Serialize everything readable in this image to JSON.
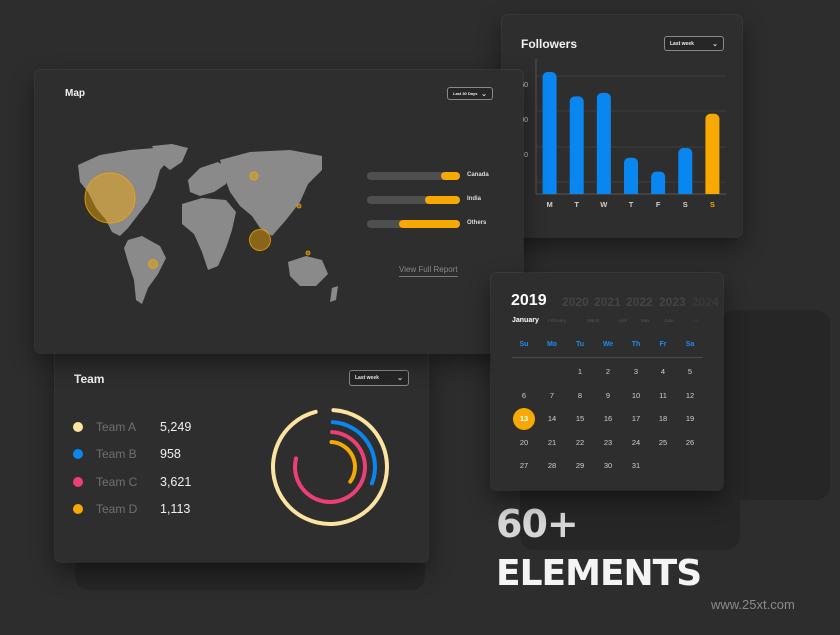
{
  "map_card": {
    "title": "Map",
    "dropdown": "Last 30 Days",
    "countries": [
      {
        "name": "Canada",
        "share": 0.2
      },
      {
        "name": "India",
        "share": 0.38
      },
      {
        "name": "Others",
        "share": 0.66
      }
    ],
    "bubbles": [
      {
        "region": "North America",
        "size": "large"
      },
      {
        "region": "India",
        "size": "medium"
      },
      {
        "region": "Brazil",
        "size": "small"
      },
      {
        "region": "Russia",
        "size": "small"
      },
      {
        "region": "China",
        "size": "tiny"
      },
      {
        "region": "Indonesia",
        "size": "tiny"
      }
    ],
    "view_report": "View Full Report",
    "accent": "#f7a900"
  },
  "followers_card": {
    "title": "Followers",
    "dropdown": "Last week",
    "chart_data": {
      "type": "bar",
      "title": "Followers",
      "categories": [
        "M",
        "T",
        "W",
        "T",
        "F",
        "S",
        "S"
      ],
      "values": [
        175,
        140,
        145,
        52,
        32,
        66,
        115
      ],
      "highlight_index": 6,
      "ytick_labels": [
        "50",
        "00",
        "0"
      ],
      "ylim": [
        0,
        185
      ],
      "grid": true,
      "colors": {
        "default": "#0a86f0",
        "highlight": "#f7a900"
      }
    }
  },
  "team_card": {
    "title": "Team",
    "dropdown": "Last week",
    "teams": [
      {
        "name": "Team A",
        "value": "5,249",
        "color": "#fde3a0"
      },
      {
        "name": "Team B",
        "value": "958",
        "color": "#0a86f0"
      },
      {
        "name": "Team C",
        "value": "3,621",
        "color": "#ec3f74"
      },
      {
        "name": "Team D",
        "value": "1,113",
        "color": "#f7a900"
      }
    ],
    "chart_data": {
      "type": "radial-bar",
      "categories": [
        "Team A",
        "Team B",
        "Team C",
        "Team D"
      ],
      "fractions": [
        0.95,
        0.3,
        0.78,
        0.34
      ]
    }
  },
  "calendar": {
    "years": [
      "2019",
      "2020",
      "2021",
      "2022",
      "2023",
      "2024"
    ],
    "active_year": "2019",
    "months": [
      "January",
      "February",
      "March",
      "April",
      "May",
      "June",
      "July"
    ],
    "active_month": "January",
    "weekdays": [
      "Su",
      "Mo",
      "Tu",
      "We",
      "Th",
      "Fr",
      "Sa"
    ],
    "first_weekday_index": 2,
    "days_in_month": 31,
    "selected_day": 13
  },
  "promo": {
    "count": "60+",
    "label": "ELEMENTS",
    "watermark": "www.25xt.com"
  }
}
